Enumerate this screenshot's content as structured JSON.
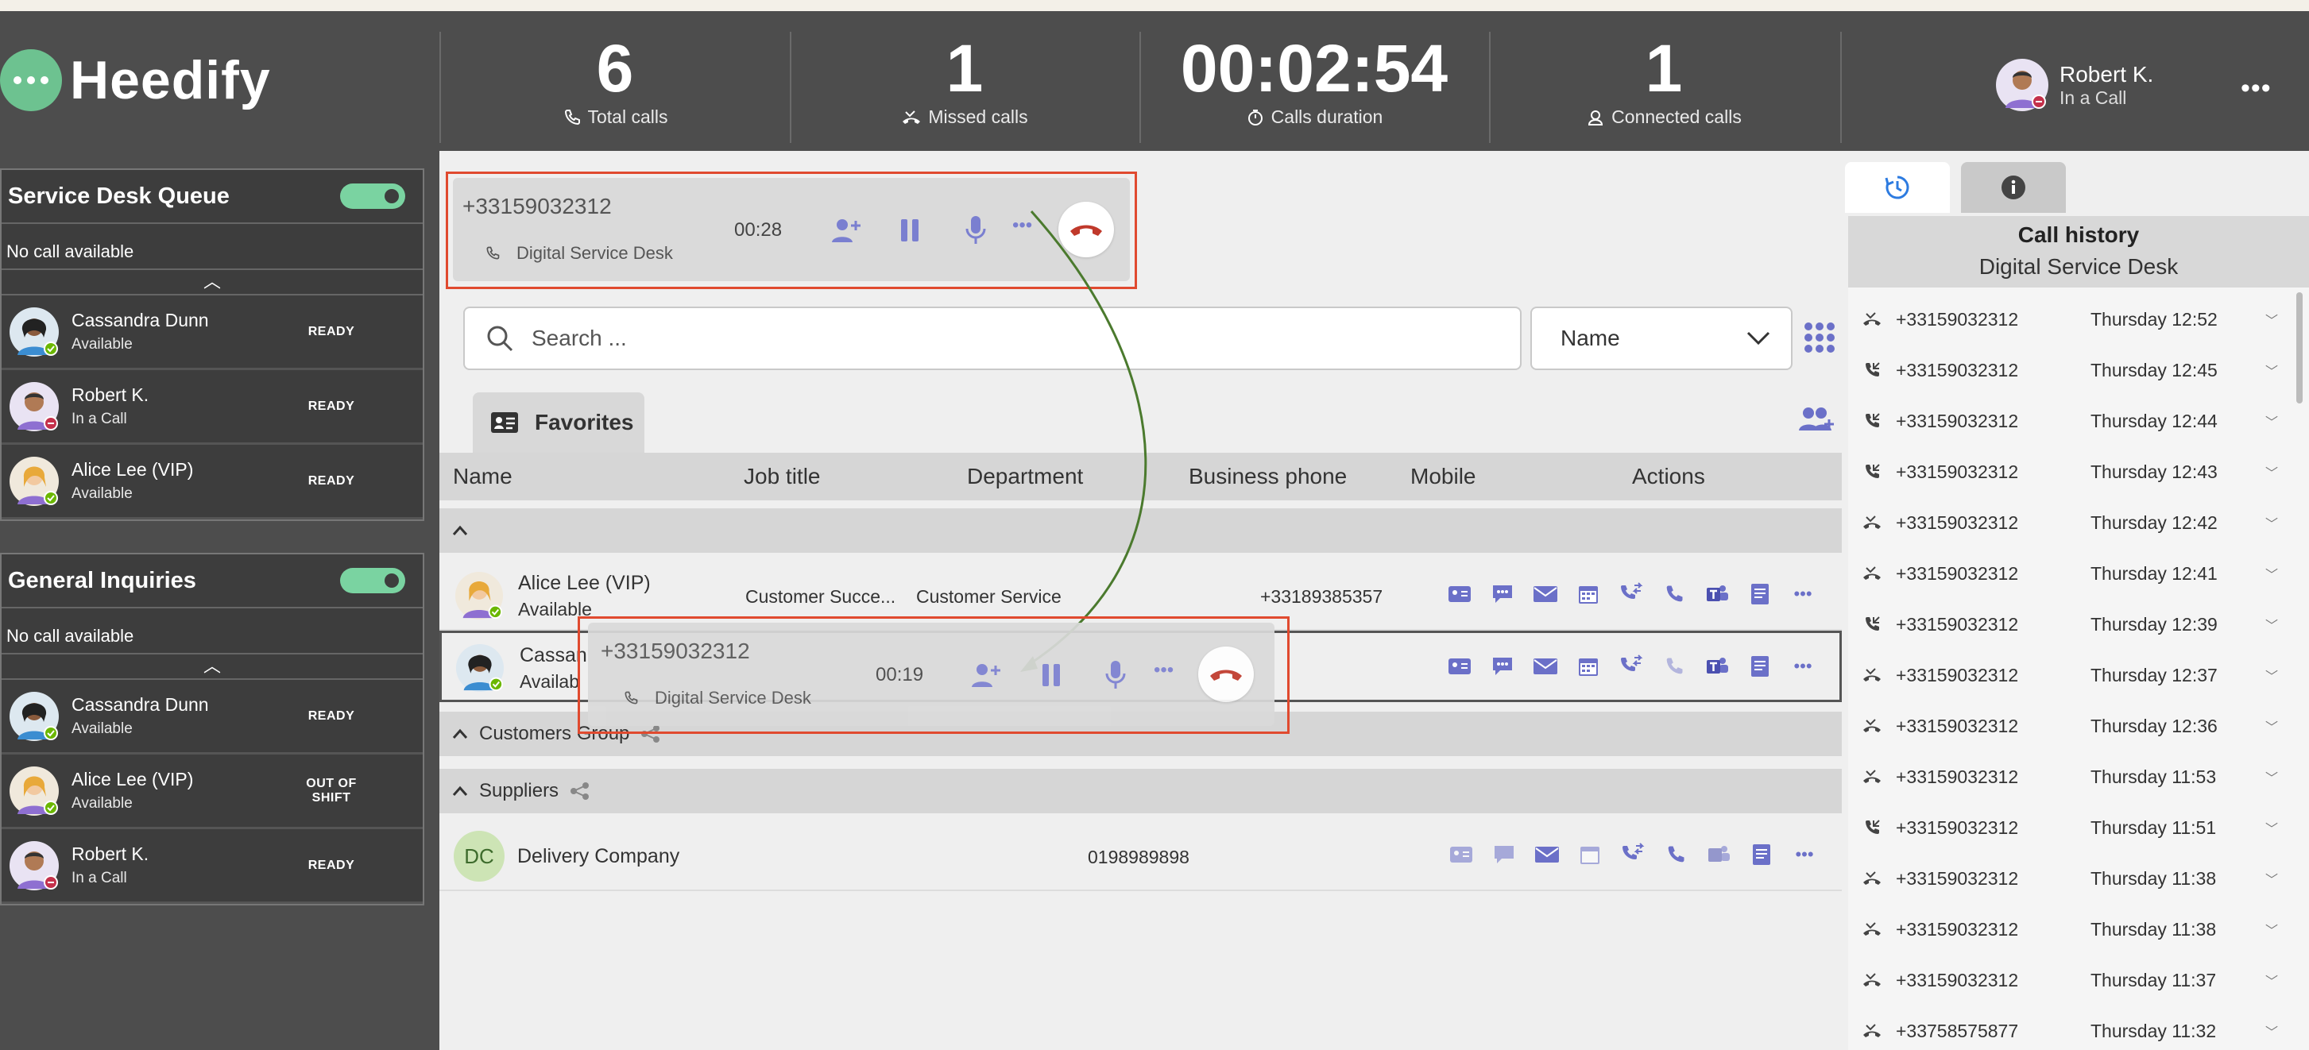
{
  "app": {
    "name": "Heedify"
  },
  "stats": [
    {
      "value": "6",
      "label": "Total calls",
      "icon": "phone-icon"
    },
    {
      "value": "1",
      "label": "Missed calls",
      "icon": "missed-call-icon"
    },
    {
      "value": "00:02:54",
      "label": "Calls duration",
      "icon": "timer-icon"
    },
    {
      "value": "1",
      "label": "Connected calls",
      "icon": "agent-icon"
    }
  ],
  "user": {
    "name": "Robert K.",
    "status": "In a Call"
  },
  "queues": [
    {
      "title": "Service Desk Queue",
      "empty": "No call available",
      "agents": [
        {
          "name": "Cassandra Dunn",
          "status": "Available",
          "state": "READY",
          "presence": "available"
        },
        {
          "name": "Robert K.",
          "status": "In a Call",
          "state": "READY",
          "presence": "busy"
        },
        {
          "name": "Alice Lee (VIP)",
          "status": "Available",
          "state": "READY",
          "presence": "available"
        }
      ]
    },
    {
      "title": "General Inquiries",
      "empty": "No call available",
      "agents": [
        {
          "name": "Cassandra Dunn",
          "status": "Available",
          "state": "READY",
          "presence": "available"
        },
        {
          "name": "Alice Lee (VIP)",
          "status": "Available",
          "state": "OUT OF SHIFT",
          "presence": "available"
        },
        {
          "name": "Robert K.",
          "status": "In a Call",
          "state": "READY",
          "presence": "busy"
        }
      ]
    }
  ],
  "active_call": {
    "number": "+33159032312",
    "queue": "Digital Service Desk",
    "duration": "00:28"
  },
  "dragged_call": {
    "number": "+33159032312",
    "queue": "Digital Service Desk",
    "duration": "00:19"
  },
  "search": {
    "placeholder": "Search ..."
  },
  "sort": {
    "selected": "Name"
  },
  "tabs": {
    "favorites": "Favorites"
  },
  "table": {
    "columns": [
      "Name",
      "Job title",
      "Department",
      "Business phone",
      "Mobile",
      "Actions"
    ],
    "rows": [
      {
        "name": "Alice Lee (VIP)",
        "status": "Available",
        "job": "Customer Succe...",
        "dept": "Customer Service",
        "phone": "+33189385357"
      },
      {
        "name": "Cassan",
        "status": "Availab"
      },
      {
        "name": "Delivery Company",
        "initials": "DC",
        "phone": "0198989898"
      }
    ],
    "groups": {
      "customers": "Customers Group",
      "suppliers": "Suppliers"
    }
  },
  "history": {
    "title": "Call history",
    "queue": "Digital Service Desk",
    "items": [
      {
        "number": "+33159032312",
        "date": "Thursday 12:52",
        "type": "missed"
      },
      {
        "number": "+33159032312",
        "date": "Thursday 12:45",
        "type": "incoming"
      },
      {
        "number": "+33159032312",
        "date": "Thursday 12:44",
        "type": "incoming"
      },
      {
        "number": "+33159032312",
        "date": "Thursday 12:43",
        "type": "incoming"
      },
      {
        "number": "+33159032312",
        "date": "Thursday 12:42",
        "type": "missed"
      },
      {
        "number": "+33159032312",
        "date": "Thursday 12:41",
        "type": "missed"
      },
      {
        "number": "+33159032312",
        "date": "Thursday 12:39",
        "type": "incoming"
      },
      {
        "number": "+33159032312",
        "date": "Thursday 12:37",
        "type": "missed"
      },
      {
        "number": "+33159032312",
        "date": "Thursday 12:36",
        "type": "missed"
      },
      {
        "number": "+33159032312",
        "date": "Thursday 11:53",
        "type": "missed"
      },
      {
        "number": "+33159032312",
        "date": "Thursday 11:51",
        "type": "incoming"
      },
      {
        "number": "+33159032312",
        "date": "Thursday 11:38",
        "type": "missed"
      },
      {
        "number": "+33159032312",
        "date": "Thursday 11:38",
        "type": "missed"
      },
      {
        "number": "+33159032312",
        "date": "Thursday 11:37",
        "type": "missed"
      },
      {
        "number": "+33758575877",
        "date": "Thursday 11:32",
        "type": "missed"
      }
    ]
  },
  "colors": {
    "accent": "#6b70c8",
    "brand": "#6dc290",
    "hangup": "#c0392b",
    "highlight": "#e04a2f"
  }
}
